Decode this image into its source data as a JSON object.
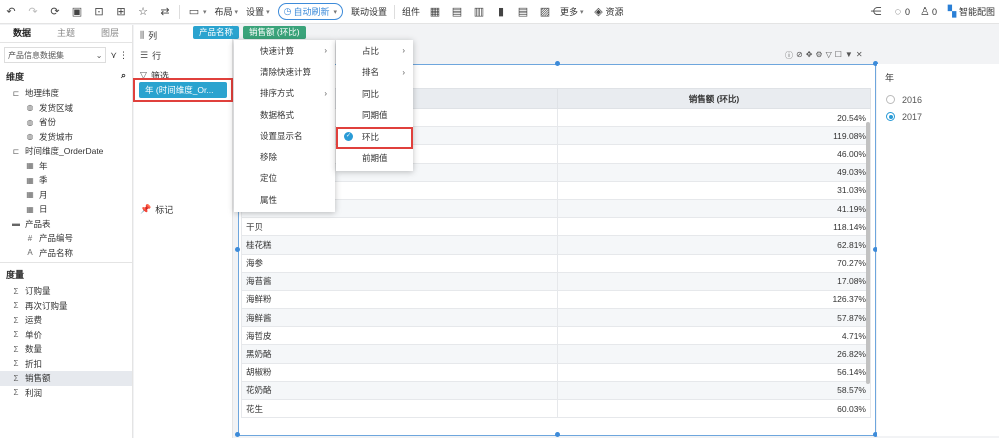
{
  "toolbar": {
    "layout": "布局",
    "settings": "设置",
    "auto_refresh": "自动刷新",
    "link_settings": "联动设置",
    "components": "组件",
    "more": "更多",
    "resources": "资源",
    "comments": "0",
    "likes": "0",
    "smart_chart": "智能配图"
  },
  "left": {
    "tabs": [
      "数据",
      "主题",
      "图层"
    ],
    "dataset": "产品信息数据集",
    "dimension_label": "维度",
    "measure_label": "度量",
    "dimensions": [
      {
        "label": "地理纬度",
        "level": 1,
        "icon": "hierarchy-icon"
      },
      {
        "label": "发货区域",
        "level": 2,
        "icon": "globe-icon"
      },
      {
        "label": "省份",
        "level": 2,
        "icon": "globe-icon"
      },
      {
        "label": "发货城市",
        "level": 2,
        "icon": "globe-icon"
      },
      {
        "label": "时间维度_OrderDate",
        "level": 1,
        "icon": "hierarchy-icon"
      },
      {
        "label": "年",
        "level": 2,
        "icon": "calendar-icon"
      },
      {
        "label": "季",
        "level": 2,
        "icon": "calendar-icon"
      },
      {
        "label": "月",
        "level": 2,
        "icon": "calendar-icon"
      },
      {
        "label": "日",
        "level": 2,
        "icon": "calendar-icon"
      },
      {
        "label": "产品表",
        "level": 1,
        "icon": "folder-icon"
      },
      {
        "label": "产品编号",
        "level": 2,
        "icon": "hash-icon"
      },
      {
        "label": "产品名称",
        "level": 2,
        "icon": "text-icon"
      }
    ],
    "measures": [
      "订购量",
      "再次订购量",
      "运费",
      "单价",
      "数量",
      "折扣",
      "销售额",
      "利润"
    ]
  },
  "mid": {
    "columns": "列",
    "rows": "行",
    "filter": "筛选",
    "filter_pill": "年 (时间维度_Or...",
    "marks": "标记"
  },
  "pills": [
    "产品名称",
    "销售额 (环比)"
  ],
  "menu1": [
    "快速计算",
    "清除快速计算",
    "排序方式",
    "数据格式",
    "设置显示名",
    "移除",
    "定位",
    "属性"
  ],
  "menu2": [
    "占比",
    "排名",
    "同比",
    "同期值",
    "环比",
    "前期值"
  ],
  "table": {
    "header_value": "销售额 (环比)",
    "rows": [
      {
        "name": "",
        "value": "20.54%"
      },
      {
        "name": "",
        "value": "119.08%"
      },
      {
        "name": "",
        "value": "46.00%"
      },
      {
        "name": "",
        "value": "49.03%"
      },
      {
        "name": "",
        "value": "31.03%"
      },
      {
        "name": "",
        "value": "41.19%"
      },
      {
        "name": "干贝",
        "value": "118.14%"
      },
      {
        "name": "桂花糕",
        "value": "62.81%"
      },
      {
        "name": "海参",
        "value": "70.27%"
      },
      {
        "name": "海苔酱",
        "value": "17.08%"
      },
      {
        "name": "海鲜粉",
        "value": "126.37%"
      },
      {
        "name": "海鲜酱",
        "value": "57.87%"
      },
      {
        "name": "海哲皮",
        "value": "4.71%"
      },
      {
        "name": "黑奶酪",
        "value": "26.82%"
      },
      {
        "name": "胡椒粉",
        "value": "56.14%"
      },
      {
        "name": "花奶酪",
        "value": "58.57%"
      },
      {
        "name": "花生",
        "value": "60.03%"
      }
    ]
  },
  "legend": {
    "title": "年",
    "options": [
      {
        "label": "2016",
        "selected": false
      },
      {
        "label": "2017",
        "selected": true
      }
    ]
  }
}
